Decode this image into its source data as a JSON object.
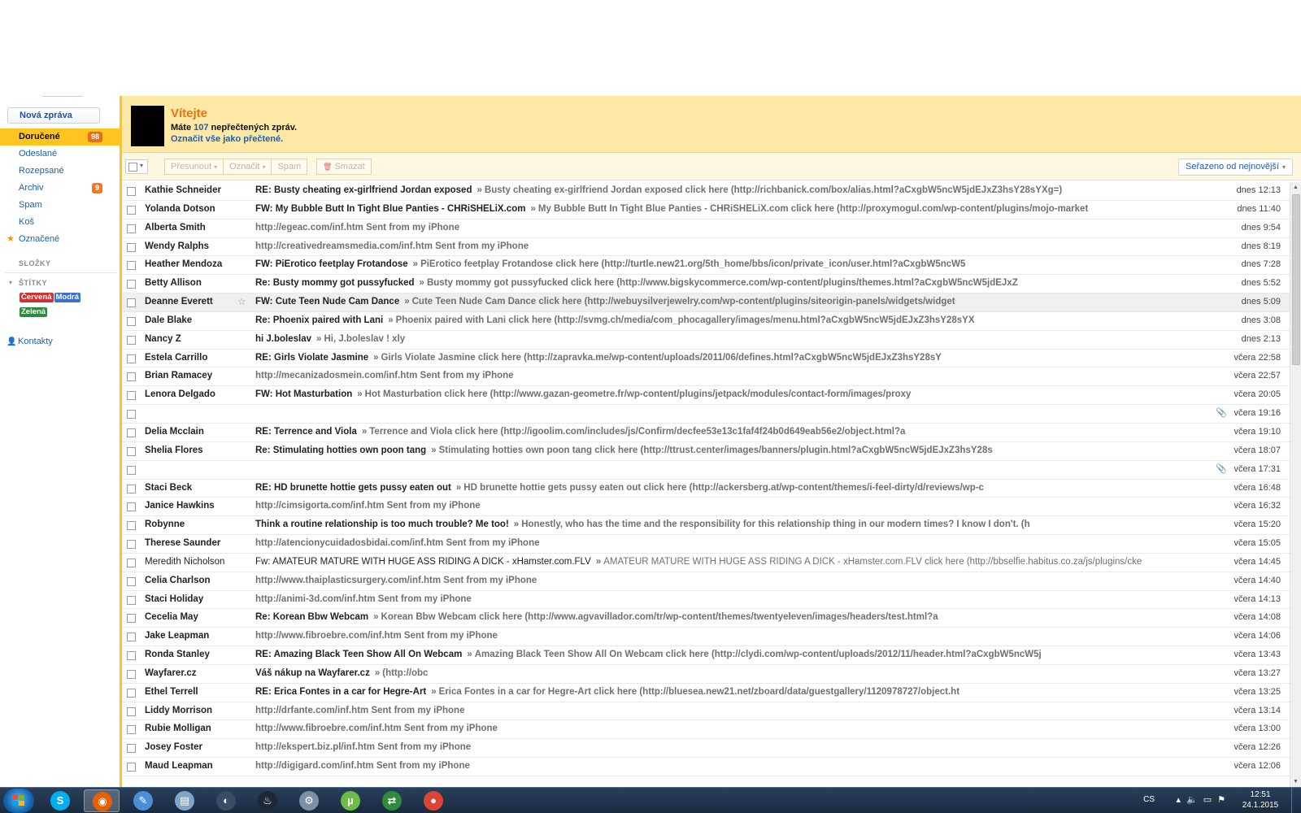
{
  "sidebar": {
    "compose_label": "Nová zpráva",
    "nav": [
      {
        "label": "Doručené",
        "count": "98",
        "active": true
      },
      {
        "label": "Odeslané"
      },
      {
        "label": "Rozepsané"
      },
      {
        "label": "Archiv",
        "count": "9"
      },
      {
        "label": "Spam"
      },
      {
        "label": "Koš"
      },
      {
        "label": "Označené",
        "starred": true
      }
    ],
    "folders_heading": "SLOŽKY",
    "labels_heading": "ŠTÍTKY",
    "labels": [
      {
        "text": "Červená",
        "color": "#cc3333"
      },
      {
        "text": "Modrá",
        "color": "#3d6fd0"
      },
      {
        "text": "Zelená",
        "color": "#2f8a3f"
      }
    ],
    "contacts_label": "Kontakty"
  },
  "welcome": {
    "title": "Vítejte",
    "msg_prefix": "Máte",
    "unread_count": "107",
    "msg_suffix": "nepřečtených zpráv.",
    "mark_all_read": "Označit vše jako přečtené."
  },
  "toolbar": {
    "move_label": "Přesunout",
    "mark_label": "Označit",
    "spam_label": "Spam",
    "delete_label": "Smazat",
    "sort_label": "Seřazeno od nejnovější"
  },
  "emails": [
    {
      "sender": "Kathie Schneider",
      "subject": "RE: Busty cheating ex-girlfriend Jordan exposed",
      "preview": "Busty cheating ex-girlfriend Jordan exposed click here (http://richbanick.com/box/alias.html?aCxgbW5ncW5jdEJxZ3hsY28sYXg=)",
      "date": "dnes 12:13"
    },
    {
      "sender": "Yolanda Dotson",
      "subject": "FW: My Bubble Butt In Tight Blue Panties - CHRiSHELiX.com",
      "preview": "My Bubble Butt In Tight Blue Panties - CHRiSHELiX.com click here (http://proxymogul.com/wp-content/plugins/mojo-market",
      "date": "dnes 11:40"
    },
    {
      "sender": "Alberta Smith",
      "subject": "",
      "preview": "http://egeac.com/inf.htm Sent from my iPhone",
      "date": "dnes 9:54"
    },
    {
      "sender": "Wendy Ralphs",
      "subject": "",
      "preview": "http://creativedreamsmedia.com/inf.htm Sent from my iPhone",
      "date": "dnes 8:19"
    },
    {
      "sender": "Heather Mendoza",
      "subject": "FW: PiErotico feetplay Frotandose",
      "preview": "PiErotico feetplay Frotandose click here (http://turtle.new21.org/5th_home/bbs/icon/private_icon/user.html?aCxgbW5ncW5",
      "date": "dnes 7:28"
    },
    {
      "sender": "Betty Allison",
      "subject": "Re: Busty mommy got pussyfucked",
      "preview": "Busty mommy got pussyfucked click here (http://www.bigskycommerce.com/wp-content/plugins/themes.html?aCxgbW5ncW5jdEJxZ",
      "date": "dnes 5:52"
    },
    {
      "sender": "Deanne Everett",
      "subject": "FW: Cute Teen Nude Cam Dance",
      "preview": "Cute Teen Nude Cam Dance click here (http://webuysilverjewelry.com/wp-content/plugins/siteorigin-panels/widgets/widget",
      "date": "dnes 5:09",
      "hover": true,
      "star": true
    },
    {
      "sender": "Dale Blake",
      "subject": "Re: Phoenix paired with Lani",
      "preview": "Phoenix paired with Lani click here (http://svmg.ch/media/com_phocagallery/images/menu.html?aCxgbW5ncW5jdEJxZ3hsY28sYX",
      "date": "dnes 3:08"
    },
    {
      "sender": "Nancy Z",
      "subject": "hi J.boleslav",
      "preview": "Hi, J.boleslav ! xly",
      "date": "dnes 2:13"
    },
    {
      "sender": "Estela Carrillo",
      "subject": "RE: Girls Violate Jasmine",
      "preview": "Girls Violate Jasmine click here (http://zapravka.me/wp-content/uploads/2011/06/defines.html?aCxgbW5ncW5jdEJxZ3hsY28sY",
      "date": "včera 22:58"
    },
    {
      "sender": "Brian Ramacey",
      "subject": "",
      "preview": "http://mecanizadosmein.com/inf.htm Sent from my iPhone",
      "date": "včera 22:57"
    },
    {
      "sender": "Lenora Delgado",
      "subject": "FW: Hot Masturbation",
      "preview": "Hot Masturbation click here (http://www.gazan-geometre.fr/wp-content/plugins/jetpack/modules/contact-form/images/proxy",
      "date": "včera 20:05"
    },
    {
      "sender": "",
      "subject": "",
      "preview": "",
      "date": "včera 19:16",
      "clip": true
    },
    {
      "sender": "Delia Mcclain",
      "subject": "RE: Terrence and Viola",
      "preview": "Terrence and Viola click here (http://igoolim.com/includes/js/Confirm/decfee53e13c1faf4f24b0d649eab56e2/object.html?a",
      "date": "včera 19:10"
    },
    {
      "sender": "Shelia Flores",
      "subject": "Re: Stimulating hotties own poon tang",
      "preview": "Stimulating hotties own poon tang click here (http://ttrust.center/images/banners/plugin.html?aCxgbW5ncW5jdEJxZ3hsY28s",
      "date": "včera 18:07"
    },
    {
      "sender": "",
      "subject": "",
      "preview": "",
      "date": "včera 17:31",
      "clip": true
    },
    {
      "sender": "Staci Beck",
      "subject": "RE: HD brunette hottie gets pussy eaten out",
      "preview": "HD brunette hottie gets pussy eaten out click here (http://ackersberg.at/wp-content/themes/i-feel-dirty/d/reviews/wp-c",
      "date": "včera 16:48"
    },
    {
      "sender": "Janice Hawkins",
      "subject": "",
      "preview": "http://cimsigorta.com/inf.htm Sent from my iPhone",
      "date": "včera 16:32"
    },
    {
      "sender": "Robynne",
      "subject": "Think a routine relationship is too much trouble? Me too!",
      "preview": "Honestly, who has the time and the responsibility for this relationship thing in our modern times? I know I don't. (h",
      "date": "včera 15:20"
    },
    {
      "sender": "Therese Saunder",
      "subject": "",
      "preview": "http://atencionycuidadosbidai.com/inf.htm Sent from my iPhone",
      "date": "včera 15:05"
    },
    {
      "sender": "Meredith Nicholson",
      "subject": "Fw: AMATEUR MATURE WITH HUGE ASS RIDING A DICK - xHamster.com.FLV",
      "preview": "AMATEUR MATURE WITH HUGE ASS RIDING A DICK - xHamster.com.FLV click here (http://bbselfie.habitus.co.za/js/plugins/cke",
      "date": "včera 14:45",
      "read": true
    },
    {
      "sender": "Celia Charlson",
      "subject": "",
      "preview": "http://www.thaiplasticsurgery.com/inf.htm Sent from my iPhone",
      "date": "včera 14:40"
    },
    {
      "sender": "Staci Holiday",
      "subject": "",
      "preview": "http://animi-3d.com/inf.htm Sent from my iPhone",
      "date": "včera 14:13"
    },
    {
      "sender": "Cecelia May",
      "subject": "Re: Korean Bbw Webcam",
      "preview": "Korean Bbw Webcam click here (http://www.agvavillador.com/tr/wp-content/themes/twentyeleven/images/headers/test.html?a",
      "date": "včera 14:08"
    },
    {
      "sender": "Jake Leapman",
      "subject": "",
      "preview": "http://www.fibroebre.com/inf.htm Sent from my iPhone",
      "date": "včera 14:06"
    },
    {
      "sender": "Ronda Stanley",
      "subject": "RE: Amazing Black Teen Show All On Webcam",
      "preview": "Amazing Black Teen Show All On Webcam click here (http://clydi.com/wp-content/uploads/2012/11/header.html?aCxgbW5ncW5j",
      "date": "včera 13:43"
    },
    {
      "sender": "Wayfarer.cz",
      "subject": "Váš nákup na Wayfarer.cz",
      "preview": "(http://obc",
      "date": "včera 13:27"
    },
    {
      "sender": "Ethel Terrell",
      "subject": "RE: Erica Fontes in a car for Hegre-Art",
      "preview": "Erica Fontes in a car for Hegre-Art click here (http://bluesea.new21.net/zboard/data/guestgallery/1120978727/object.ht",
      "date": "včera 13:25"
    },
    {
      "sender": "Liddy Morrison",
      "subject": "",
      "preview": "http://drfante.com/inf.htm Sent from my iPhone",
      "date": "včera 13:14"
    },
    {
      "sender": "Rubie Molligan",
      "subject": "",
      "preview": "http://www.fibroebre.com/inf.htm Sent from my iPhone",
      "date": "včera 13:00"
    },
    {
      "sender": "Josey Foster",
      "subject": "",
      "preview": "http://ekspert.biz.pl/inf.htm Sent from my iPhone",
      "date": "včera 12:26"
    },
    {
      "sender": "Maud Leapman",
      "subject": "",
      "preview": "http://digigard.com/inf.htm Sent from my iPhone",
      "date": "včera 12:06"
    }
  ],
  "taskbar": {
    "lang": "CS",
    "time": "12:51",
    "date": "24.1.2015",
    "apps": [
      {
        "name": "skype",
        "glyph": "S",
        "color": "#00aff0"
      },
      {
        "name": "firefox",
        "glyph": "◉",
        "color": "#e66000",
        "active": true
      },
      {
        "name": "paint",
        "glyph": "✎",
        "color": "#4b8fd6"
      },
      {
        "name": "notepad",
        "glyph": "▤",
        "color": "#7fa6c9"
      },
      {
        "name": "media",
        "glyph": "◐",
        "color": "#3a4b66"
      },
      {
        "name": "steam",
        "glyph": "♨",
        "color": "#1b2838"
      },
      {
        "name": "tools",
        "glyph": "⚙",
        "color": "#7d8fa3"
      },
      {
        "name": "utorrent",
        "glyph": "µ",
        "color": "#6bbd45"
      },
      {
        "name": "sync",
        "glyph": "⇄",
        "color": "#2e8b3e"
      },
      {
        "name": "chrome",
        "glyph": "●",
        "color": "#db4437"
      }
    ]
  }
}
